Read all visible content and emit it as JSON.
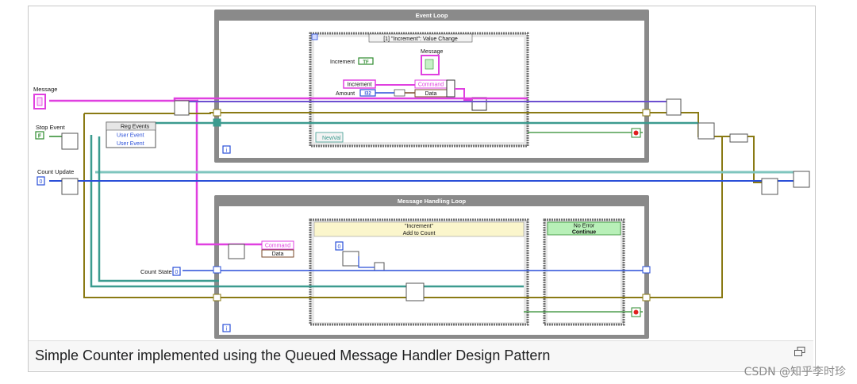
{
  "loops": {
    "event_loop": "Event Loop",
    "message_handling_loop": "Message Handling Loop"
  },
  "controls": {
    "message": "Message",
    "stop_event": "Stop Event",
    "count_update": "Count Update",
    "count_state": "Count State",
    "reg_events": "Reg Events",
    "user_event_1": "User Event",
    "user_event_2": "User Event",
    "stop_const": "F",
    "count_update_const": "0",
    "count_state_const": "0"
  },
  "event_case": {
    "selector": "[1] \"Increment\": Value Change",
    "increment": "Increment",
    "increment_type": "TF",
    "message_label": "Message",
    "increment_cluster": "Increment",
    "amount": "Amount",
    "amount_type": "I32",
    "command": "Command",
    "data": "Data",
    "newval": "NewVal",
    "iteration": "i"
  },
  "message_case": {
    "selector": "\"Increment\"",
    "subtitle": "Add to Count",
    "command": "Command",
    "data": "Data",
    "const_zero": "0",
    "error_selector": "No Error",
    "error_subtitle": "Continue",
    "iteration": "i"
  },
  "caption": "Simple Counter implemented using the Queued Message Handler Design Pattern",
  "watermark": "CSDN @知乎李时珍",
  "colors": {
    "loop_frame": "#6e6e6e",
    "loop_title": "#ffffff",
    "case_fill": "#fbf6cc",
    "case_title": "#f4f0b8",
    "noerror_fill": "#b8f0b8",
    "wire_pink": "#e040e0",
    "wire_blue": "#2a4fd8",
    "wire_teal": "#3c9b8f",
    "wire_olive": "#8a7a14",
    "wire_green": "#2c8a2c"
  }
}
